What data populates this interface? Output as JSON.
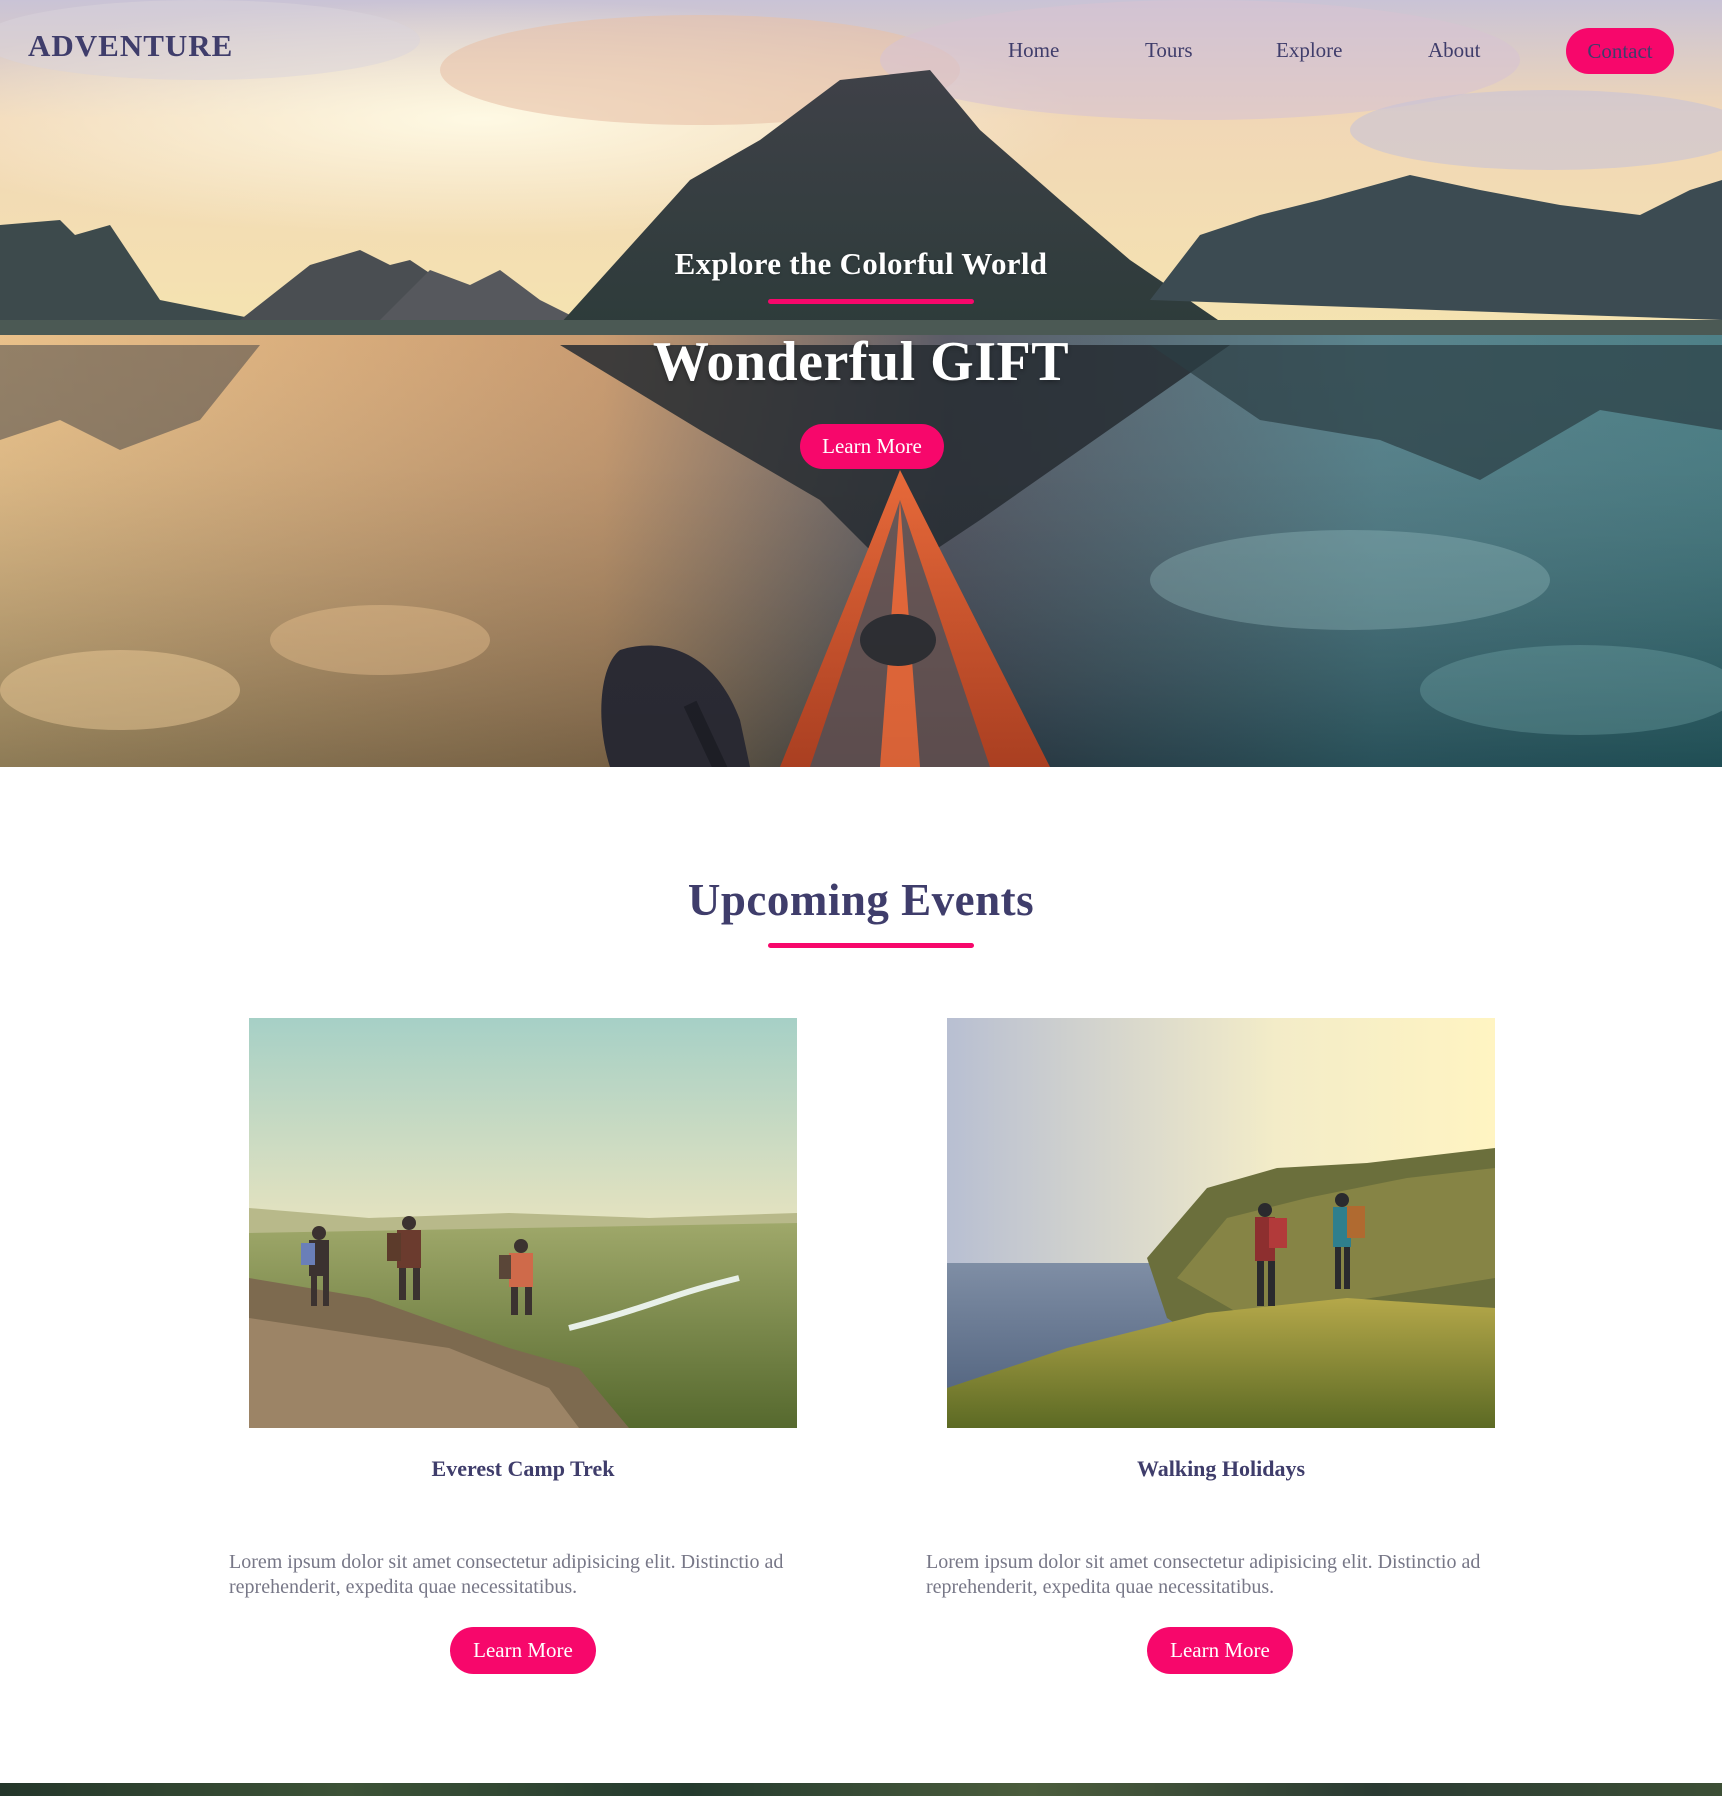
{
  "nav": {
    "brand": "ADVENTURE",
    "links": [
      "Home",
      "Tours",
      "Explore",
      "About"
    ],
    "contact": "Contact"
  },
  "hero": {
    "subtitle": "Explore the Colorful World",
    "title": "Wonderful GIFT",
    "button": "Learn More"
  },
  "events": {
    "heading": "Upcoming Events",
    "cards": [
      {
        "title": "Everest Camp Trek",
        "text": "Lorem ipsum dolor sit amet consectetur adipisicing elit. Distinctio ad reprehenderit, expedita quae necessitatibus.",
        "button": "Learn More"
      },
      {
        "title": "Walking Holidays",
        "text": "Lorem ipsum dolor sit amet consectetur adipisicing elit. Distinctio ad reprehenderit, expedita quae necessitatibus.",
        "button": "Learn More"
      }
    ]
  },
  "colors": {
    "accent": "#f7076b",
    "text": "#3f3d6b",
    "muted": "#777787"
  }
}
